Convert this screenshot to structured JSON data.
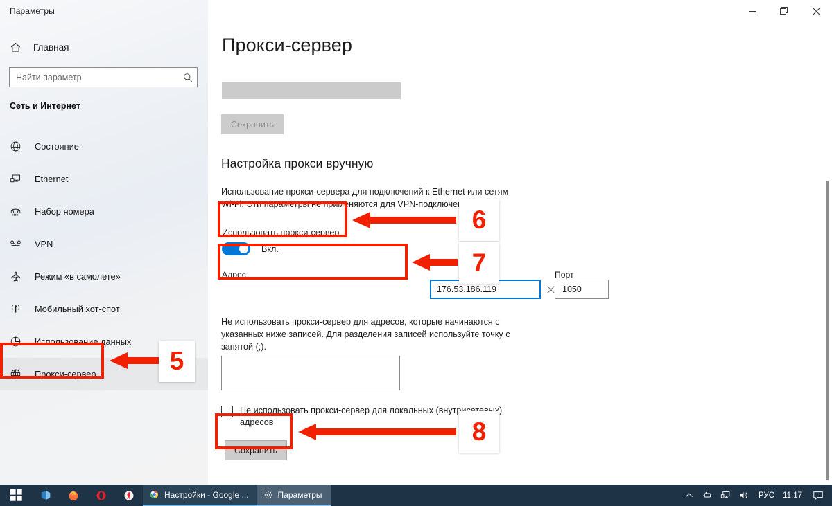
{
  "window": {
    "title": "Параметры",
    "controls": {
      "minimize": "minimize-icon",
      "restore": "restore-icon",
      "close": "close-icon"
    }
  },
  "sidebar": {
    "home_label": "Главная",
    "home_icon": "home-icon",
    "search": {
      "placeholder": "Найти параметр",
      "value": "",
      "icon": "search-icon"
    },
    "section_header": "Сеть и Интернет",
    "items": [
      {
        "label": "Состояние",
        "icon": "globe-status-icon",
        "selected": false
      },
      {
        "label": "Ethernet",
        "icon": "ethernet-icon",
        "selected": false
      },
      {
        "label": "Набор номера",
        "icon": "dialup-icon",
        "selected": false
      },
      {
        "label": "VPN",
        "icon": "vpn-icon",
        "selected": false
      },
      {
        "label": "Режим «в самолете»",
        "icon": "airplane-icon",
        "selected": false
      },
      {
        "label": "Мобильный хот-спот",
        "icon": "hotspot-icon",
        "selected": false
      },
      {
        "label": "Использование данных",
        "icon": "data-usage-icon",
        "selected": false
      },
      {
        "label": "Прокси-сервер",
        "icon": "proxy-globe-icon",
        "selected": true
      }
    ]
  },
  "main": {
    "page_title": "Прокси-сервер",
    "save_top_label": "Сохранить",
    "manual_heading": "Настройка прокси вручную",
    "manual_description": "Использование прокси-сервера для подключений к Ethernet или сетям Wi-Fi. Эти параметры не применяются для VPN-подключений.",
    "use_proxy_label": "Использовать прокси-сервер",
    "use_proxy_state": "Вкл.",
    "address_label": "Адрес",
    "address_value": "176.53.186.119",
    "address_clear_icon": "clear-x-icon",
    "port_label": "Порт",
    "port_value": "1050",
    "exceptions_description": "Не использовать прокси-сервер для адресов, которые начинаются с указанных ниже записей. Для разделения записей используйте точку с запятой (;).",
    "exceptions_value": "",
    "bypass_local_label": "Не использовать прокси-сервер для локальных (внутрисетевых) адресов",
    "bypass_local_checked": false,
    "save_bottom_label": "Сохранить"
  },
  "annotations": {
    "accent_color": "#f02000",
    "steps": [
      {
        "number": "5",
        "target": "sidebar-item-proxy"
      },
      {
        "number": "6",
        "target": "use-proxy-toggle"
      },
      {
        "number": "7",
        "target": "address-port-fields"
      },
      {
        "number": "8",
        "target": "save-button-bottom"
      }
    ]
  },
  "taskbar": {
    "start_icon": "windows-start-icon",
    "pinned": [
      {
        "name": "microsoft-store-icon"
      },
      {
        "name": "firefox-icon"
      },
      {
        "name": "opera-icon"
      },
      {
        "name": "yandex-browser-icon"
      }
    ],
    "windows": [
      {
        "label": "Настройки - Google ...",
        "icon": "chrome-icon",
        "active": false
      },
      {
        "label": "Параметры",
        "icon": "settings-gear-icon",
        "active": true
      }
    ],
    "tray": {
      "chevron_icon": "chevron-up-icon",
      "icons": [
        "usb-safe-remove-icon",
        "network-icon",
        "volume-icon"
      ],
      "language": "РУС",
      "clock": "11:17",
      "action_center_icon": "action-center-icon"
    }
  },
  "colors": {
    "accent_blue": "#0078d7",
    "annotation_red": "#f02000",
    "taskbar": "#1f3347",
    "disabled_gray": "#cccccc"
  }
}
